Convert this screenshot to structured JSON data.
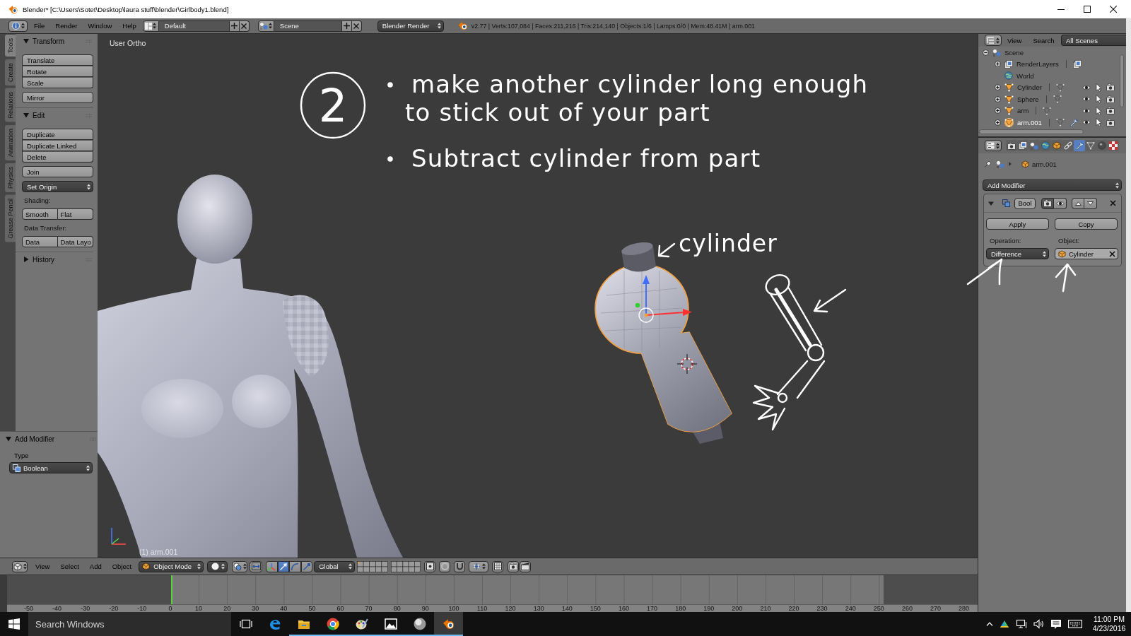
{
  "window": {
    "title": "Blender* [C:\\Users\\Sotet\\Desktop\\laura stuff\\blender\\Girlbody1.blend]"
  },
  "info_header": {
    "menus": [
      "File",
      "Render",
      "Window",
      "Help"
    ],
    "screen_layout": "Default",
    "scene": "Scene",
    "render_engine": "Blender Render",
    "stats": "v2.77 | Verts:107,084 | Faces:211,216 | Tris:214,140 | Objects:1/6 | Lamps:0/0 | Mem:48.41M | arm.001"
  },
  "tool_shelf": {
    "tabs": [
      {
        "label": "Tools",
        "selected": true
      },
      {
        "label": "Create",
        "selected": false
      },
      {
        "label": "Relations",
        "selected": false
      },
      {
        "label": "Animation",
        "selected": false
      },
      {
        "label": "Physics",
        "selected": false
      },
      {
        "label": "Grease Pencil",
        "selected": false
      }
    ],
    "panels": [
      {
        "title": "Transform",
        "expanded": true,
        "items": [
          {
            "kind": "buttons",
            "buttons": [
              "Translate",
              "Rotate",
              "Scale"
            ]
          },
          {
            "kind": "buttons",
            "buttons": [
              "Mirror"
            ]
          }
        ]
      },
      {
        "title": "Edit",
        "expanded": true,
        "items": [
          {
            "kind": "buttons",
            "buttons": [
              "Duplicate",
              "Duplicate Linked",
              "Delete"
            ]
          },
          {
            "kind": "buttons",
            "buttons": [
              "Join"
            ]
          },
          {
            "kind": "dropdown",
            "value": "Set Origin"
          },
          {
            "kind": "label",
            "text": "Shading:"
          },
          {
            "kind": "button_row",
            "buttons": [
              "Smooth",
              "Flat"
            ]
          },
          {
            "kind": "label",
            "text": "Data Transfer:"
          },
          {
            "kind": "button_row",
            "buttons": [
              "Data",
              "Data Layo"
            ]
          }
        ]
      },
      {
        "title": "History",
        "expanded": false
      }
    ],
    "operator_panel": {
      "title": "Add Modifier",
      "expanded": true,
      "field_label": "Type",
      "value": "Boolean"
    }
  },
  "viewport": {
    "view_name": "User Ortho",
    "object_info": "(1) arm.001",
    "step_number": "2",
    "bullets": [
      {
        "lines": [
          "make another cylinder long enough",
          "to stick out of your part"
        ]
      },
      {
        "lines": [
          "Subtract cylinder from part"
        ]
      }
    ],
    "callout": "cylinder"
  },
  "view_header": {
    "menus": [
      "View",
      "Select",
      "Add",
      "Object"
    ],
    "mode": "Object Mode",
    "manipulators": [
      {
        "kind": "axes",
        "selected": false
      },
      {
        "kind": "translate",
        "selected": true
      },
      {
        "kind": "rotate",
        "selected": false
      },
      {
        "kind": "scale",
        "selected": false
      }
    ],
    "orientation": "Global"
  },
  "timeline": {
    "range_start": {
      "level": 0.169
    },
    "range_end": {
      "level": 0.903
    },
    "playhead": {
      "level": 0.169
    },
    "ruler_labels": [
      "-50",
      "-40",
      "-30",
      "-20",
      "-10",
      "0",
      "10",
      "20",
      "30",
      "40",
      "50",
      "60",
      "70",
      "80",
      "90",
      "100",
      "110",
      "120",
      "130",
      "140",
      "150",
      "160",
      "170",
      "180",
      "190",
      "200",
      "210",
      "220",
      "230",
      "240",
      "250",
      "260",
      "270",
      "280"
    ]
  },
  "outliner": {
    "menus": [
      "View",
      "Search"
    ],
    "display_mode": "All Scenes",
    "tree": [
      {
        "label": "Scene",
        "kind": "scene",
        "expanded": true,
        "children": [
          {
            "label": "RenderLayers",
            "kind": "render_layers",
            "expanded": false
          },
          {
            "label": "World",
            "kind": "world"
          },
          {
            "label": "Cylinder",
            "kind": "object",
            "expanded": false,
            "selected": false,
            "has_modifier": false
          },
          {
            "label": "Sphere",
            "kind": "object",
            "expanded": false,
            "selected": false,
            "has_modifier": false
          },
          {
            "label": "arm",
            "kind": "object",
            "expanded": false,
            "selected": false,
            "has_modifier": false
          },
          {
            "label": "arm.001",
            "kind": "object",
            "expanded": false,
            "selected": true,
            "has_modifier": true
          }
        ]
      }
    ]
  },
  "properties": {
    "tabs": [
      {
        "kind": "render",
        "selected": false
      },
      {
        "kind": "render_layers",
        "selected": false
      },
      {
        "kind": "scene",
        "selected": false
      },
      {
        "kind": "world",
        "selected": false
      },
      {
        "kind": "object",
        "selected": false
      },
      {
        "kind": "constraints",
        "selected": false
      },
      {
        "kind": "modifiers",
        "selected": true
      },
      {
        "kind": "data",
        "selected": false
      },
      {
        "kind": "material",
        "selected": false
      },
      {
        "kind": "texture",
        "selected": false
      }
    ],
    "context_object": "arm.001",
    "add_modifier": "Add Modifier",
    "modifier": {
      "name": "Bool",
      "expanded": true,
      "apply": "Apply",
      "copy": "Copy",
      "operation_label": "Operation:",
      "operation": "Difference",
      "object_label": "Object:",
      "object": "Cylinder"
    }
  },
  "taskbar": {
    "search_placeholder": "Search Windows",
    "apps": [
      {
        "kind": "browser_e",
        "running": false,
        "selected": false
      },
      {
        "kind": "folder",
        "running": true,
        "selected": false
      },
      {
        "kind": "browser_circle",
        "running": true,
        "selected": false
      },
      {
        "kind": "palette",
        "running": true,
        "selected": false
      },
      {
        "kind": "picture",
        "running": true,
        "selected": false
      },
      {
        "kind": "sphere",
        "running": true,
        "selected": false
      },
      {
        "kind": "app_logo",
        "running": true,
        "selected": true
      }
    ],
    "time": "11:00 PM",
    "date": "4/23/2016"
  }
}
